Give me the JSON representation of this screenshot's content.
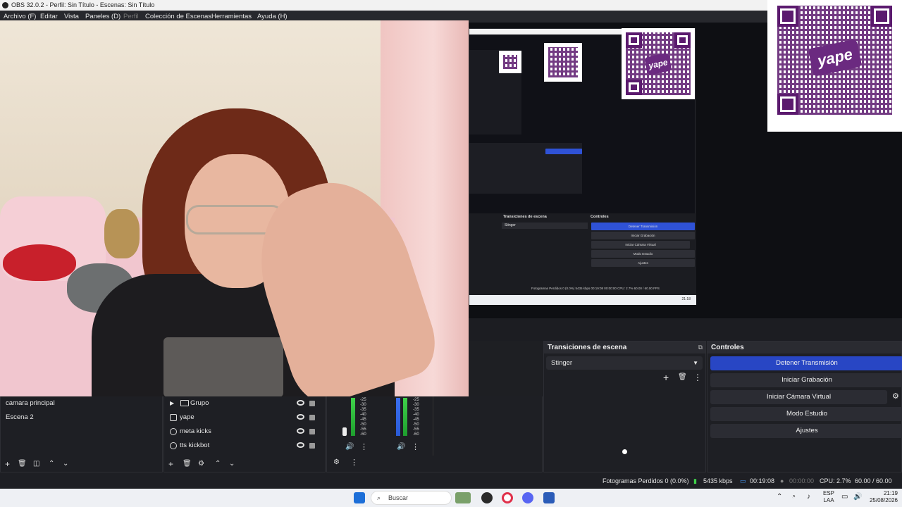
{
  "titlebar": {
    "title": "OBS 32.0.2 - Perfil: Sin Título - Escenas: Sin Título"
  },
  "menu": {
    "items": [
      "Archivo (F)",
      "Editar",
      "Vista",
      "Paneles (D)",
      "Perfil",
      "Colección de Escenas",
      "Herramientas",
      "Ayuda (H)"
    ]
  },
  "qr": {
    "logo_text": "yape"
  },
  "nested_preview": {
    "transitions_title": "Transiciones de escena",
    "controls_title": "Controles",
    "stinger": "Stinger",
    "buttons": [
      "Detener Transmisión",
      "Iniciar Grabación",
      "Iniciar Cámara Virtual",
      "Modo Estudio",
      "Ajustes"
    ],
    "status": "Fotogramas Perdidos 0 (0.0%)   5435 kbps   00:19:08   00:00:00   CPU: 2.7%   60.00 / 60.00 FPS",
    "clock": "21:18"
  },
  "scenes": {
    "items": [
      "camara principal",
      "Escena 2"
    ]
  },
  "sources": {
    "items": [
      "Grupo",
      "yape",
      "meta kicks",
      "tts kickbot"
    ]
  },
  "mixer": {
    "ticks": [
      "-25",
      "-30",
      "-35",
      "-40",
      "-45",
      "-50",
      "-55",
      "-60"
    ]
  },
  "transitions": {
    "title": "Transiciones de escena",
    "selected": "Stinger"
  },
  "controls": {
    "title": "Controles",
    "stop_stream": "Detener Transmisión",
    "start_record": "Iniciar Grabación",
    "start_vcam": "Iniciar Cámara Virtual",
    "studio_mode": "Modo Estudio",
    "settings": "Ajustes"
  },
  "status": {
    "dropped": "Fotogramas Perdidos 0 (0.0%)",
    "bitrate": "5435 kbps",
    "stream_time": "00:19:08",
    "record_time": "00:00:00",
    "cpu": "CPU: 2.7%",
    "fps": "60.00 / 60.00 FPS"
  },
  "taskbar": {
    "search_placeholder": "Buscar",
    "lang": "ESP",
    "lang2": "LAA",
    "time": "21:19",
    "date": "25/08/2026"
  },
  "colors": {
    "accent": "#2846c4",
    "yape_purple": "#5b1a6e"
  }
}
